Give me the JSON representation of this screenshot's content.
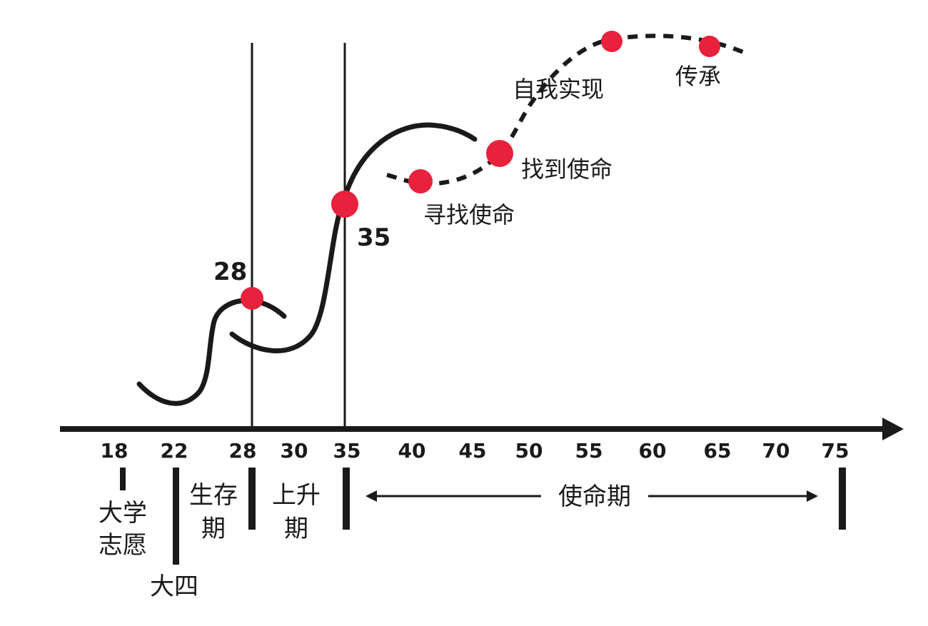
{
  "axis": {
    "ticks": [
      "18",
      "22",
      "28",
      "30",
      "35",
      "40",
      "45",
      "50",
      "55",
      "60",
      "65",
      "70",
      "75"
    ]
  },
  "markers": {
    "age_28": "28",
    "age_35": "35"
  },
  "stages": {
    "college": {
      "line1": "大学",
      "line2": "志愿"
    },
    "senior": "大四",
    "survival": {
      "line1": "生存",
      "line2": "期"
    },
    "rising": {
      "line1": "上升",
      "line2": "期"
    },
    "mission": "使命期"
  },
  "milestones": {
    "seek": "寻找使命",
    "found": "找到使命",
    "self": "自我实现",
    "legacy": "传承"
  },
  "colors": {
    "ink": "#1a1a1a",
    "dot": "#e8213c"
  }
}
